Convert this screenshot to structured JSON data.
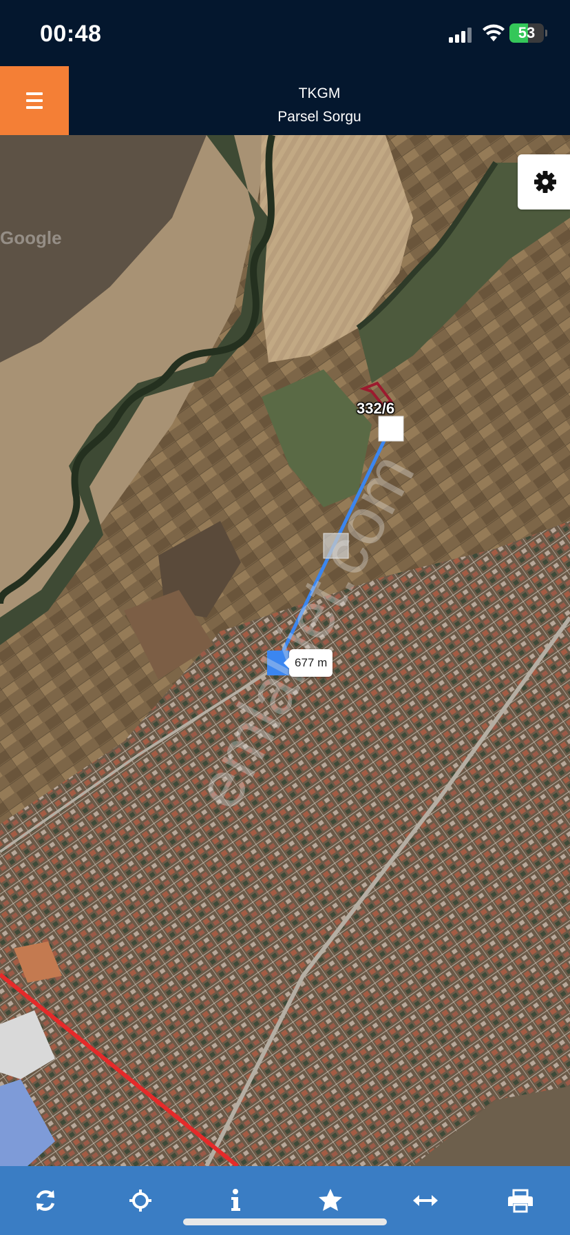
{
  "status_bar": {
    "time": "00:48",
    "battery": "53",
    "battery_level": 0.53,
    "icons": [
      "cellular-signal-icon",
      "wifi-icon",
      "battery-charging-icon"
    ]
  },
  "header": {
    "title": "TKGM",
    "subtitle": "Parsel Sorgu",
    "menu_icon": "hamburger-menu-icon",
    "accent_color": "#f47f36",
    "background_color": "#04172e"
  },
  "map": {
    "provider_mark": "Google",
    "watermark": "emlakjet.com",
    "parcel_label": "332/6",
    "distance_label": "677 m",
    "settings_icon": "gear-icon",
    "measure_line_color": "#3b86f0",
    "parcel_outline_color": "#9b1b2e",
    "boundary_line_color": "#e52a2a"
  },
  "toolbar": {
    "background_color": "#3a7dc4",
    "items": [
      {
        "name": "refresh",
        "icon": "refresh-icon"
      },
      {
        "name": "locate",
        "icon": "crosshair-icon"
      },
      {
        "name": "info",
        "icon": "info-icon"
      },
      {
        "name": "favorite",
        "icon": "star-icon"
      },
      {
        "name": "measure",
        "icon": "horizontal-arrows-icon"
      },
      {
        "name": "print",
        "icon": "printer-icon"
      }
    ]
  }
}
